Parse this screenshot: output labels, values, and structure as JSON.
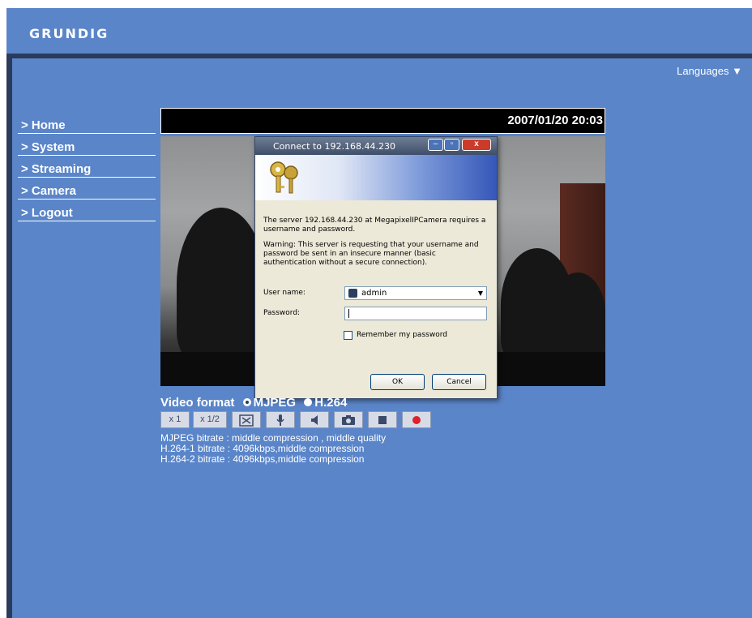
{
  "header": {
    "logo_text": "GRUNDIG"
  },
  "languages": {
    "label": "Languages ▼"
  },
  "nav": {
    "items": [
      {
        "label": "> Home"
      },
      {
        "label": "> System"
      },
      {
        "label": "> Streaming"
      },
      {
        "label": "> Camera"
      },
      {
        "label": "> Logout"
      }
    ]
  },
  "video": {
    "timestamp": "2007/01/20 20:03"
  },
  "dialog": {
    "title": "Connect to 192.168.44.230",
    "minimize": "–",
    "maximize": "▫",
    "close": "x",
    "message": "The server 192.168.44.230 at MegapixelIPCamera requires a username and password.",
    "warning": "Warning: This server is requesting that your username and password be sent in an insecure manner (basic authentication without a secure connection).",
    "username_label": "User name:",
    "username_value": "admin",
    "password_label": "Password:",
    "password_value": "",
    "remember_label": "Remember my password",
    "remember_checked": false,
    "ok_label": "OK",
    "cancel_label": "Cancel"
  },
  "format": {
    "label": "Video format",
    "options": [
      "MJPEG",
      "H.264"
    ],
    "selected": "MJPEG"
  },
  "controls": {
    "zoom_x1": "x 1",
    "zoom_half": "x 1/2"
  },
  "info": {
    "mjpeg": "MJPEG bitrate : middle compression , middle quality",
    "h264_1": "H.264-1 bitrate : 4096kbps,middle compression",
    "h264_2": "H.264-2 bitrate : 4096kbps,middle compression"
  },
  "colors": {
    "background": "#5a85c9",
    "dark_bar": "#2b3b5c",
    "record": "#e0202a"
  }
}
